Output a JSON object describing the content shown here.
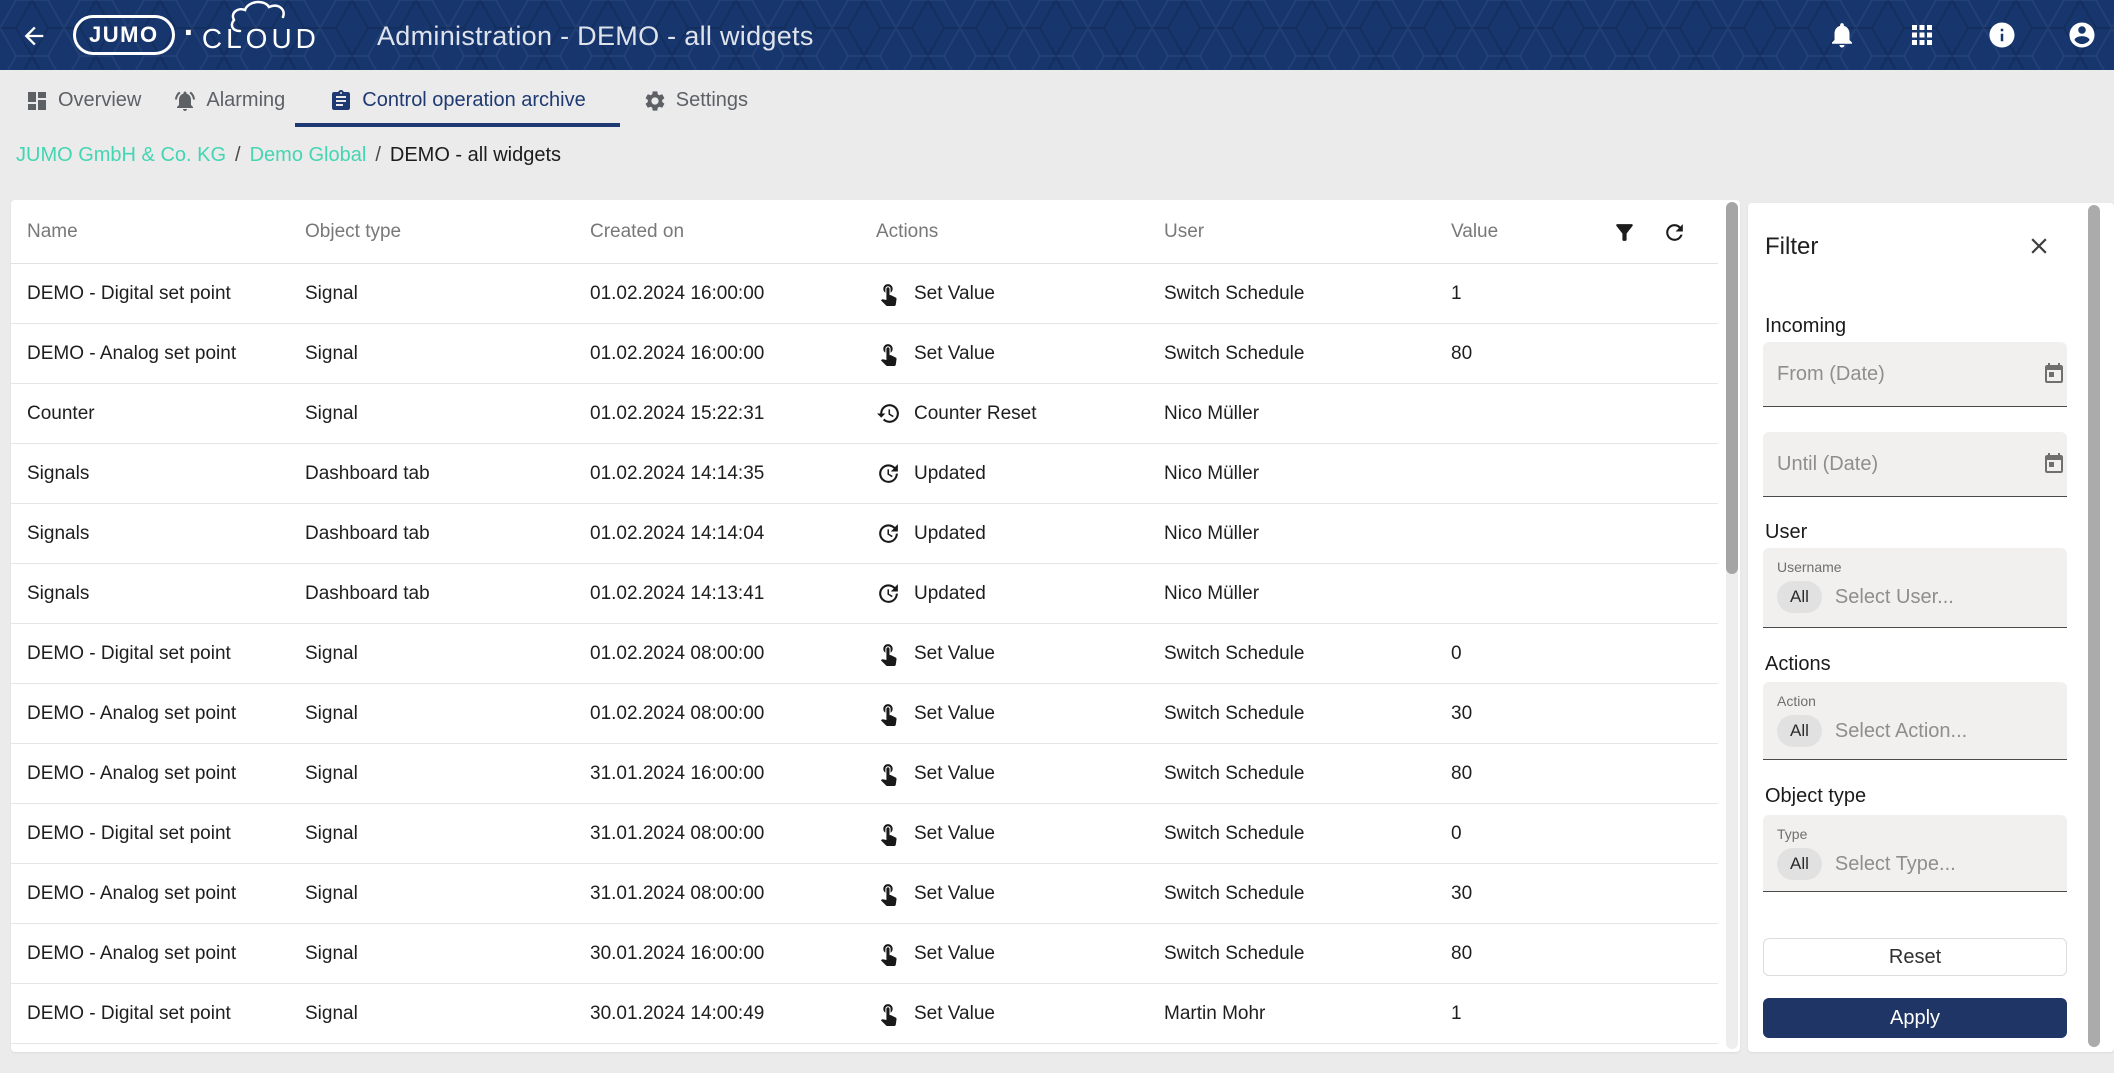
{
  "header": {
    "title": "Administration - DEMO - all widgets",
    "logo": {
      "brand": "JUMO",
      "separator": "·",
      "product": "CLOUD"
    },
    "icons": [
      "back-icon",
      "notifications-icon",
      "apps-grid-icon",
      "info-icon",
      "account-icon"
    ]
  },
  "tabs": [
    {
      "label": "Overview",
      "icon": "dashboard-icon",
      "active": false
    },
    {
      "label": "Alarming",
      "icon": "alarm-bell-icon",
      "active": false
    },
    {
      "label": "Control operation archive",
      "icon": "clipboard-icon",
      "active": true
    },
    {
      "label": "Settings",
      "icon": "gear-icon",
      "active": false
    }
  ],
  "breadcrumb": {
    "separator": "/",
    "items": [
      {
        "label": "JUMO GmbH & Co. KG",
        "link": true
      },
      {
        "label": "Demo Global",
        "link": true
      },
      {
        "label": "DEMO - all widgets",
        "link": false
      }
    ]
  },
  "table": {
    "columns": [
      "Name",
      "Object type",
      "Created on",
      "Actions",
      "User",
      "Value"
    ],
    "tool_icons": [
      "filter-funnel-icon",
      "refresh-icon"
    ],
    "rows": [
      {
        "name": "DEMO - Digital set point",
        "object_type": "Signal",
        "created_on": "01.02.2024 16:00:00",
        "icon": "touch",
        "action": "Set Value",
        "user": "Switch Schedule",
        "value": "1"
      },
      {
        "name": "DEMO - Analog set point",
        "object_type": "Signal",
        "created_on": "01.02.2024 16:00:00",
        "icon": "touch",
        "action": "Set Value",
        "user": "Switch Schedule",
        "value": "80"
      },
      {
        "name": "Counter",
        "object_type": "Signal",
        "created_on": "01.02.2024 15:22:31",
        "icon": "history",
        "action": "Counter Reset",
        "user": "Nico Müller",
        "value": ""
      },
      {
        "name": "Signals",
        "object_type": "Dashboard tab",
        "created_on": "01.02.2024 14:14:35",
        "icon": "update",
        "action": "Updated",
        "user": "Nico Müller",
        "value": ""
      },
      {
        "name": "Signals",
        "object_type": "Dashboard tab",
        "created_on": "01.02.2024 14:14:04",
        "icon": "update",
        "action": "Updated",
        "user": "Nico Müller",
        "value": ""
      },
      {
        "name": "Signals",
        "object_type": "Dashboard tab",
        "created_on": "01.02.2024 14:13:41",
        "icon": "update",
        "action": "Updated",
        "user": "Nico Müller",
        "value": ""
      },
      {
        "name": "DEMO - Digital set point",
        "object_type": "Signal",
        "created_on": "01.02.2024 08:00:00",
        "icon": "touch",
        "action": "Set Value",
        "user": "Switch Schedule",
        "value": "0"
      },
      {
        "name": "DEMO - Analog set point",
        "object_type": "Signal",
        "created_on": "01.02.2024 08:00:00",
        "icon": "touch",
        "action": "Set Value",
        "user": "Switch Schedule",
        "value": "30"
      },
      {
        "name": "DEMO - Analog set point",
        "object_type": "Signal",
        "created_on": "31.01.2024 16:00:00",
        "icon": "touch",
        "action": "Set Value",
        "user": "Switch Schedule",
        "value": "80"
      },
      {
        "name": "DEMO - Digital set point",
        "object_type": "Signal",
        "created_on": "31.01.2024 08:00:00",
        "icon": "touch",
        "action": "Set Value",
        "user": "Switch Schedule",
        "value": "0"
      },
      {
        "name": "DEMO - Analog set point",
        "object_type": "Signal",
        "created_on": "31.01.2024 08:00:00",
        "icon": "touch",
        "action": "Set Value",
        "user": "Switch Schedule",
        "value": "30"
      },
      {
        "name": "DEMO - Analog set point",
        "object_type": "Signal",
        "created_on": "30.01.2024 16:00:00",
        "icon": "touch",
        "action": "Set Value",
        "user": "Switch Schedule",
        "value": "80"
      },
      {
        "name": "DEMO - Digital set point",
        "object_type": "Signal",
        "created_on": "30.01.2024 14:00:49",
        "icon": "touch",
        "action": "Set Value",
        "user": "Martin Mohr",
        "value": "1"
      }
    ]
  },
  "filter": {
    "title": "Filter",
    "close_icon": "close-icon",
    "sections": {
      "incoming": {
        "label": "Incoming",
        "from_placeholder": "From (Date)",
        "until_placeholder": "Until (Date)",
        "calendar_icon": "calendar-icon"
      },
      "user": {
        "label": "User",
        "field_label": "Username",
        "chip": "All",
        "placeholder": "Select User..."
      },
      "actions": {
        "label": "Actions",
        "field_label": "Action",
        "chip": "All",
        "placeholder": "Select Action..."
      },
      "object_type": {
        "label": "Object type",
        "field_label": "Type",
        "chip": "All",
        "placeholder": "Select Type..."
      }
    },
    "reset_label": "Reset",
    "apply_label": "Apply"
  },
  "colors": {
    "header_bg": "#17366e",
    "active_tab_blue": "#1f3a73",
    "breadcrumb_link_teal": "#44d5b3",
    "apply_button_bg": "#1e3566",
    "page_bg": "#ebebeb"
  }
}
